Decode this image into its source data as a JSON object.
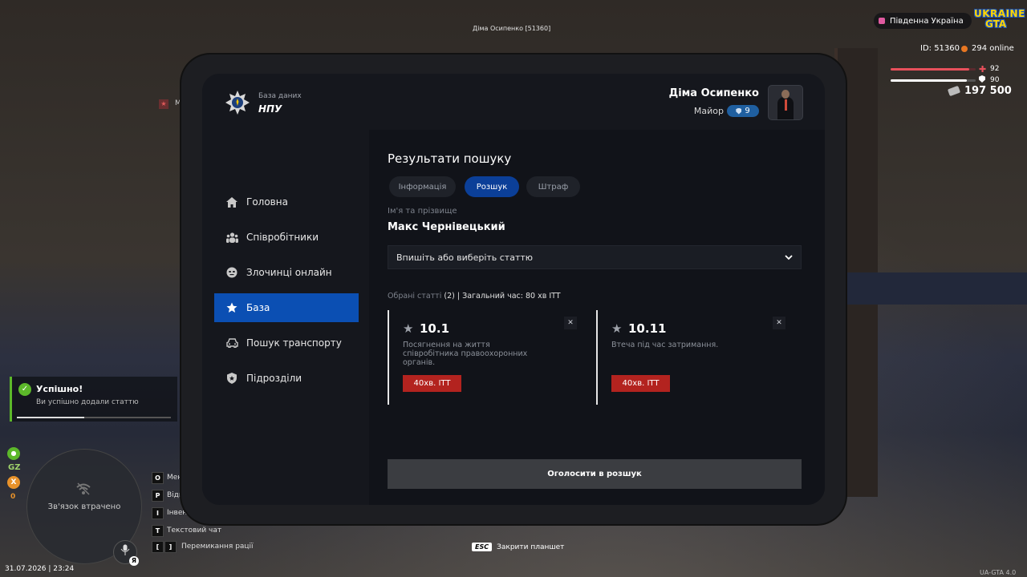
{
  "world": {
    "player_tag": "Діма Осипенко [51360]",
    "left_badge_icon": "★",
    "left_badge_text": "M"
  },
  "hud": {
    "region": "Південна Україна",
    "logo_top": "UKRAINE",
    "logo_bottom": "GTA",
    "id": "ID: 51360",
    "online": "294 online",
    "health": 92,
    "armor": 90,
    "money": "197 500",
    "health_color": "#e8505b",
    "armor_color": "#ffffff"
  },
  "toast": {
    "icon": "✓",
    "title": "Успішно!",
    "text": "Ви успішно додали статтю",
    "progress": 0.44
  },
  "minimap": {
    "status": "Зв'язок втрачено",
    "gz_label": "GZ",
    "x_label": "X",
    "x_count": "0",
    "mic_badge": "Я",
    "datetime": "31.07.2026 | 23:24"
  },
  "hotkeys": [
    {
      "key": "O",
      "label": "Мені"
    },
    {
      "key": "P",
      "label": "Відк"
    },
    {
      "key": "I",
      "label": "Інвент"
    },
    {
      "key": "T",
      "label": "Текстовий чат"
    },
    {
      "key1": "[",
      "key2": "]",
      "label": "Перемикання рації"
    }
  ],
  "esc_hint": {
    "key": "ESC",
    "label": "Закрити планшет"
  },
  "version": "UA-GTA 4.0",
  "tablet": {
    "brand_sub": "База даних",
    "brand_title": "НПУ",
    "user": {
      "name": "Діма Осипенко",
      "rank": "Майор",
      "level": "9"
    },
    "nav": [
      {
        "label": "Головна",
        "icon": "home-icon"
      },
      {
        "label": "Співробітники",
        "icon": "users-icon"
      },
      {
        "label": "Злочинці онлайн",
        "icon": "mask-icon"
      },
      {
        "label": "База",
        "icon": "star-icon",
        "active": true
      },
      {
        "label": "Пошук транспорту",
        "icon": "car-icon"
      },
      {
        "label": "Підрозділи",
        "icon": "shield-icon"
      }
    ],
    "results_title": "Результати пошуку",
    "tabs": [
      {
        "label": "Інформація"
      },
      {
        "label": "Розшук",
        "active": true
      },
      {
        "label": "Штраф"
      }
    ],
    "name_label": "Ім'я та прізвище",
    "name_value": "Макс Чернівецький",
    "select_placeholder": "Впишіть або виберіть статтю",
    "summary": {
      "label": "Обрані статті",
      "count": "(2)",
      "total": "| Загальний час: 80 хв ITT"
    },
    "articles": [
      {
        "code": "10.1",
        "desc": "Посягнення на життя співробітника правоохоронних органів.",
        "penalty": "40хв. ITT",
        "close": "✕"
      },
      {
        "code": "10.11",
        "desc": "Втеча під час затримання.",
        "penalty": "40хв. ITT",
        "close": "✕"
      }
    ],
    "submit_label": "Оголосити в розшук"
  }
}
